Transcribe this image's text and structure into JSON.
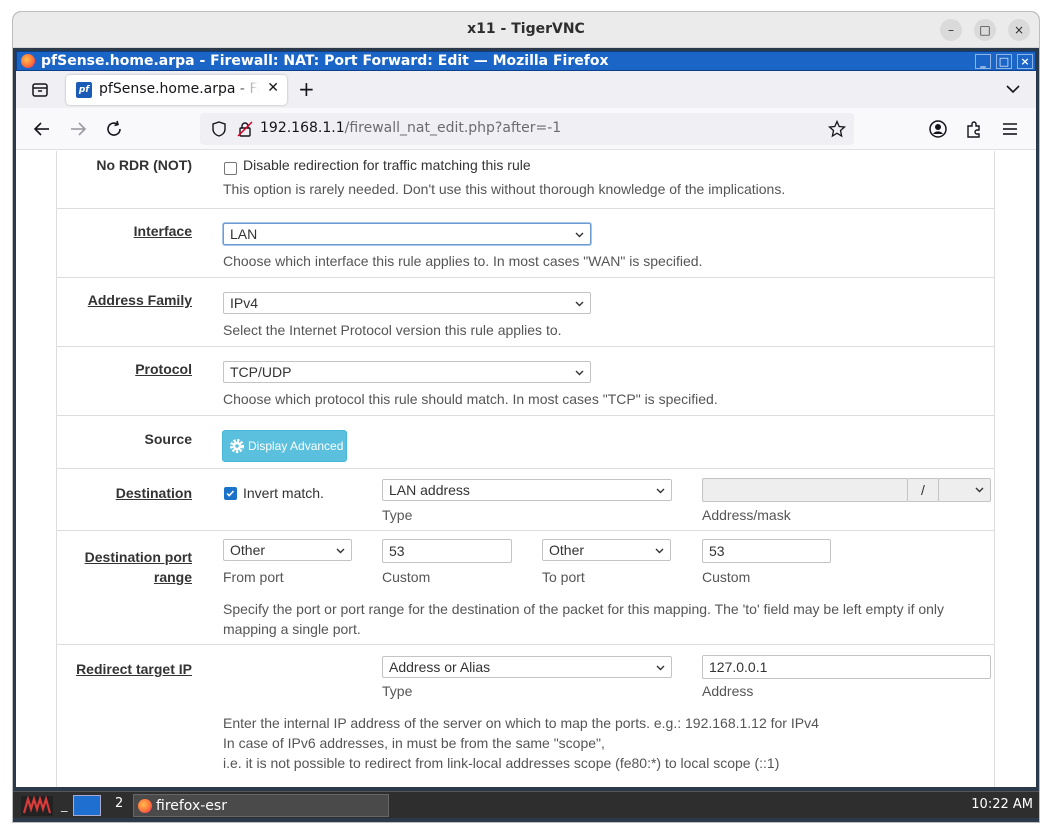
{
  "vnc": {
    "title": "x11 - TigerVNC",
    "minimize": "–",
    "maximize": "□",
    "close": "×"
  },
  "firefox": {
    "window_title": "pfSense.home.arpa - Firewall: NAT: Port Forward: Edit — Mozilla Firefox",
    "win_min": "_",
    "win_max": "□",
    "win_close": "×",
    "tab": {
      "label": "pfSense.home.arpa - Firewall",
      "favicon_text": "pf",
      "close": "✕"
    },
    "new_tab": "+",
    "url": {
      "host": "192.168.1.1",
      "path": "/firewall_nat_edit.php?after=-1"
    }
  },
  "form": {
    "no_rdr": {
      "label": "No RDR (NOT)",
      "checkbox_label": "Disable redirection for traffic matching this rule",
      "checked": false,
      "help": "This option is rarely needed. Don't use this without thorough knowledge of the implications."
    },
    "interface": {
      "label": "Interface",
      "value": "LAN",
      "help": "Choose which interface this rule applies to. In most cases \"WAN\" is specified."
    },
    "address_family": {
      "label": "Address Family",
      "value": "IPv4",
      "help": "Select the Internet Protocol version this rule applies to."
    },
    "protocol": {
      "label": "Protocol",
      "value": "TCP/UDP",
      "help": "Choose which protocol this rule should match. In most cases \"TCP\" is specified."
    },
    "source": {
      "label": "Source",
      "button_label": "Display Advanced"
    },
    "destination": {
      "label": "Destination",
      "invert_label": "Invert match.",
      "invert_checked": true,
      "type_value": "LAN address",
      "type_caption": "Type",
      "address_value": "",
      "mask_separator": "/",
      "mask_value": "",
      "address_caption": "Address/mask"
    },
    "dest_port_range": {
      "label_line1": "Destination port",
      "label_line2": "range",
      "from_port_value": "Other",
      "from_port_caption": "From port",
      "from_custom_value": "53",
      "from_custom_caption": "Custom",
      "to_port_value": "Other",
      "to_port_caption": "To port",
      "to_custom_value": "53",
      "to_custom_caption": "Custom",
      "help_line1": "Specify the port or port range for the destination of the packet for this mapping. The 'to' field may be left empty if only",
      "help_line2": "mapping a single port."
    },
    "redirect_target_ip": {
      "label": "Redirect target IP",
      "type_value": "Address or Alias",
      "type_caption": "Type",
      "address_value": "127.0.0.1",
      "address_caption": "Address",
      "help_line1": "Enter the internal IP address of the server on which to map the ports. e.g.: 192.168.1.12 for IPv4",
      "help_line2": "In case of IPv6 addresses, in must be from the same \"scope\",",
      "help_line3": "i.e. it is not possible to redirect from link-local addresses scope (fe80:*) to local scope (::1)"
    }
  },
  "taskbar": {
    "separator": "_",
    "desktop_number": "2",
    "task_label": "firefox-esr",
    "clock": "10:22 AM"
  }
}
